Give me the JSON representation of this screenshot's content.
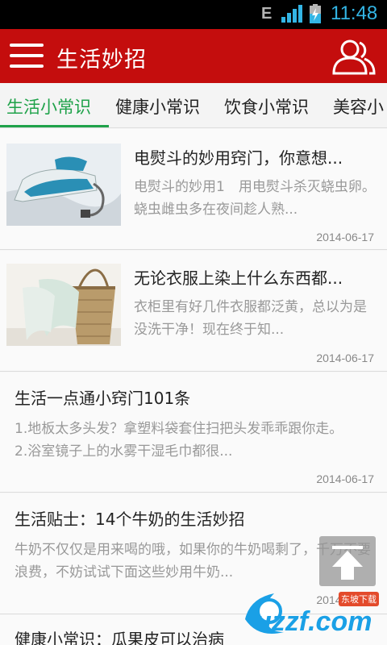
{
  "status": {
    "network": "E",
    "time": "11:48"
  },
  "appbar": {
    "title": "生活妙招",
    "menu_icon": "hamburger-menu-icon",
    "user_icon": "users-icon",
    "bg_color": "#c40d0d"
  },
  "tabs": [
    {
      "label": "生活小常识",
      "active": true
    },
    {
      "label": "健康小常识",
      "active": false
    },
    {
      "label": "饮食小常识",
      "active": false
    },
    {
      "label": "美容小",
      "active": false
    }
  ],
  "accent_color": "#1fa24a",
  "items": [
    {
      "title": "电熨斗的妙用窍门，你意想...",
      "desc": "电熨斗的妙用1　用电熨斗杀灭蛲虫卵。蛲虫雌虫多在夜间趁人熟...",
      "date": "2014-06-17",
      "thumb": "iron-image"
    },
    {
      "title": "无论衣服上染上什么东西都...",
      "desc": "衣柜里有好几件衣服都泛黄，总以为是没洗干净！现在终于知...",
      "date": "2014-06-17",
      "thumb": "laundry-basket-image"
    },
    {
      "title": "生活一点通小窍门101条",
      "desc": "1.地板太多头发？拿塑料袋套住扫把头发乖乖跟你走。　　2.浴室镜子上的水雾干湿毛巾都很...",
      "date": "2014-06-17"
    },
    {
      "title": "生活贴士：14个牛奶的生活妙招",
      "desc": "牛奶不仅仅是用来喝的哦，如果你的牛奶喝剩了，千万不要浪费，不妨试试下面这些妙用牛奶...",
      "date": "2014-06-17"
    },
    {
      "title": "健康小常识：瓜果皮可以治病",
      "desc": "",
      "date": ""
    }
  ],
  "scroll_top_icon": "arrow-up-icon",
  "watermark": {
    "text": "uzzf.com",
    "sub": "东坡下载"
  }
}
